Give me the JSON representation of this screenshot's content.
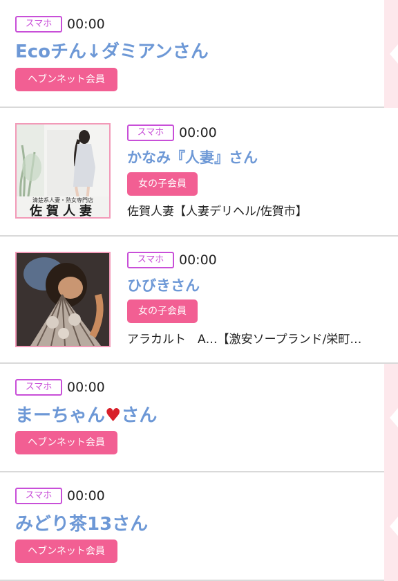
{
  "entries": [
    {
      "device": "スマホ",
      "time": "00:00",
      "name": "Ecoチん↓ダミアンさん",
      "member": "ヘブンネット会員"
    },
    {
      "device": "スマホ",
      "time": "00:00",
      "name": "かなみ『人妻』さん",
      "member": "女の子会員",
      "shop": "佐賀人妻【人妻デリヘル/佐賀市】",
      "thumb_caption_top": "清楚系人妻・熟女専門店",
      "thumb_caption_logo": "佐賀人妻"
    },
    {
      "device": "スマホ",
      "time": "00:00",
      "name": "ひびきさん",
      "member": "女の子会員",
      "shop": "アラカルト　A…【激安ソープランド/栄町…"
    },
    {
      "device": "スマホ",
      "time": "00:00",
      "name_pre": "まーちゃん",
      "name_heart": "♥",
      "name_post": "さん",
      "member": "ヘブンネット会員"
    },
    {
      "device": "スマホ",
      "time": "00:00",
      "name": "みどり茶13さん",
      "member": "ヘブンネット会員"
    }
  ],
  "colors": {
    "device_badge": "#c84fd8",
    "name": "#6d98d6",
    "member_badge": "#f25f93",
    "divider": "#d9d9d9",
    "side_strip": "#fde8ec"
  }
}
